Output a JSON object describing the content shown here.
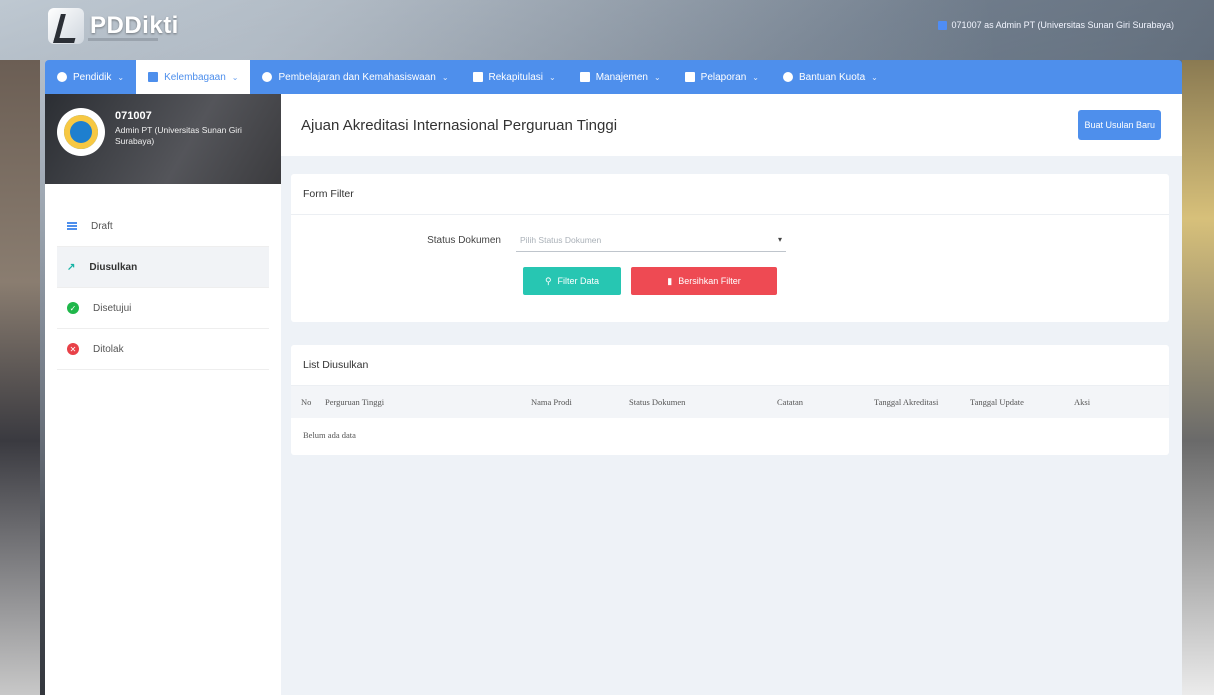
{
  "app": {
    "logo_text": "PDDikti",
    "user_label": "071007 as Admin PT (Universitas Sunan Giri Surabaya)"
  },
  "nav": [
    {
      "label": "Pendidik",
      "icon": "user-circle-icon"
    },
    {
      "label": "Kelembagaan",
      "icon": "institution-icon"
    },
    {
      "label": "Pembelajaran dan Kemahasiswaan",
      "icon": "user-circle-icon"
    },
    {
      "label": "Rekapitulasi",
      "icon": "calendar-icon"
    },
    {
      "label": "Manajemen",
      "icon": "document-icon"
    },
    {
      "label": "Pelaporan",
      "icon": "folder-icon"
    },
    {
      "label": "Bantuan Kuota",
      "icon": "user-circle-icon"
    }
  ],
  "profile": {
    "id": "071007",
    "role": "Admin PT (Universitas Sunan Giri Surabaya)"
  },
  "sidebar": {
    "items": [
      {
        "label": "Draft",
        "icon": "list-icon"
      },
      {
        "label": "Diusulkan",
        "icon": "trend-icon"
      },
      {
        "label": "Disetujui",
        "icon": "check-circle-icon"
      },
      {
        "label": "Ditolak",
        "icon": "x-circle-icon"
      }
    ]
  },
  "page": {
    "title": "Ajuan Akreditasi Internasional Perguruan Tinggi",
    "new_button": "Buat Usulan Baru"
  },
  "filter": {
    "title": "Form Filter",
    "status_label": "Status Dokumen",
    "status_placeholder": "Pilih Status Dokumen",
    "filter_button": "Filter Data",
    "clear_button": "Bersihkan Filter"
  },
  "list": {
    "title": "List Diusulkan",
    "columns": [
      "No",
      "Perguruan Tinggi",
      "Nama Prodi",
      "Status Dokumen",
      "Catatan",
      "Tanggal Akreditasi",
      "Tanggal Update",
      "Aksi"
    ],
    "empty_text": "Belum ada data"
  },
  "colors": {
    "nav": "#4e8fec",
    "teal": "#27c6b2",
    "red": "#ee4a53"
  }
}
